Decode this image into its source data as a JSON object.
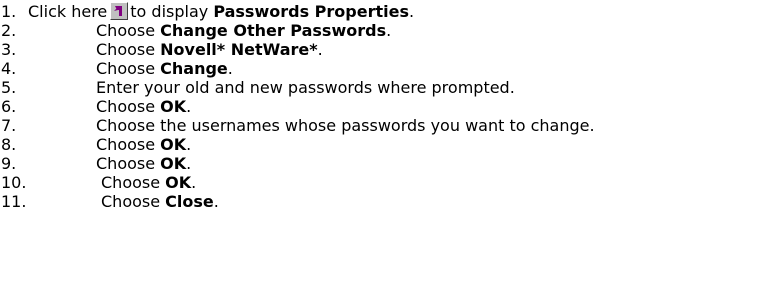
{
  "steps": [
    {
      "number": "1.",
      "before": "Click here",
      "icon": "shortcut-arrow-icon",
      "middle": "to display ",
      "bold": "Passwords Properties",
      "after": "."
    },
    {
      "number": "2.",
      "before": "Choose ",
      "bold": "Change Other Passwords",
      "after": "."
    },
    {
      "number": "3.",
      "before": "Choose ",
      "bold": "Novell* NetWare*",
      "after": "."
    },
    {
      "number": "4.",
      "before": "Choose ",
      "bold": "Change",
      "after": "."
    },
    {
      "number": "5.",
      "before": "Enter your old and new passwords where prompted.",
      "bold": "",
      "after": ""
    },
    {
      "number": "6.",
      "before": "Choose ",
      "bold": "OK",
      "after": "."
    },
    {
      "number": "7.",
      "before": "Choose the usernames whose passwords you want to change.",
      "bold": "",
      "after": ""
    },
    {
      "number": "8.",
      "before": "Choose ",
      "bold": "OK",
      "after": "."
    },
    {
      "number": "9.",
      "before": "Choose ",
      "bold": "OK",
      "after": "."
    },
    {
      "number": "10.",
      "before": "Choose ",
      "bold": "OK",
      "after": "."
    },
    {
      "number": "11.",
      "before": "Choose ",
      "bold": "Close",
      "after": "."
    }
  ],
  "colors": {
    "text": "#000000",
    "background": "#ffffff",
    "icon_face": "#c0c0c0",
    "icon_arrow": "#800080"
  }
}
